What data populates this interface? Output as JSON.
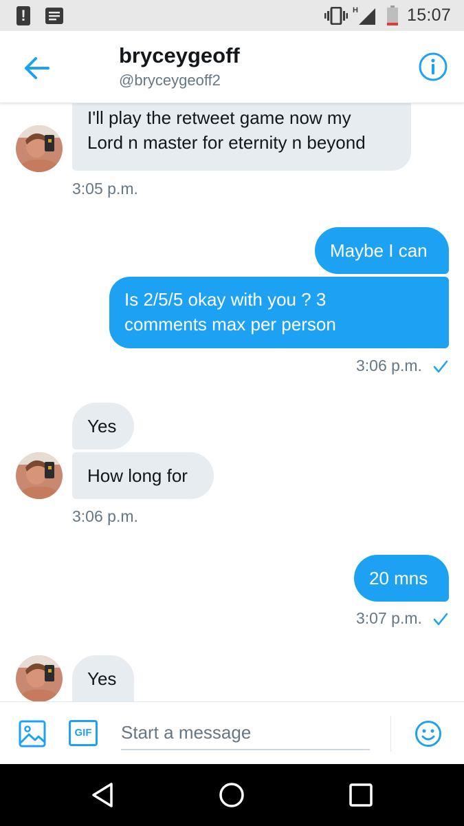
{
  "status_bar": {
    "time": "15:07",
    "network_label": "H",
    "icons": [
      "alert-icon",
      "notes-icon",
      "vibrate-icon",
      "signal-icon",
      "battery-icon"
    ]
  },
  "header": {
    "name": "bryceygeoff",
    "handle": "@bryceygeoff2",
    "icons": [
      "back-arrow-icon",
      "info-icon"
    ]
  },
  "messages": [
    {
      "from": "them",
      "text_lines": [
        "I'll play the retweet game now my",
        "Lord n master for eternity n beyond"
      ]
    },
    {
      "from": "them",
      "timestamp": "3:05 p.m."
    },
    {
      "from": "me",
      "text_lines": [
        "Maybe I can"
      ]
    },
    {
      "from": "me",
      "text_lines": [
        "Is 2/5/5 okay with you ? 3",
        "comments max per person"
      ]
    },
    {
      "from": "me",
      "timestamp": "3:06 p.m.",
      "read": true
    },
    {
      "from": "them",
      "text_lines": [
        "Yes"
      ]
    },
    {
      "from": "them",
      "text_lines": [
        "How long for"
      ]
    },
    {
      "from": "them",
      "timestamp": "3:06 p.m."
    },
    {
      "from": "me",
      "text_lines": [
        "20 mns"
      ]
    },
    {
      "from": "me",
      "timestamp": "3:07 p.m.",
      "read": true
    },
    {
      "from": "them",
      "text_lines": [
        "Yes"
      ]
    }
  ],
  "composer": {
    "placeholder": "Start a message",
    "gif_label": "GIF",
    "icons": [
      "image-icon",
      "gif-icon",
      "emoji-icon"
    ]
  },
  "nav_bar": {
    "icons": [
      "nav-back-icon",
      "nav-home-icon",
      "nav-recents-icon"
    ]
  },
  "colors": {
    "accent": "#1da1f2",
    "incoming_bubble": "#e6ecf0",
    "status_bar": "#e8e8e8",
    "battery_low": "#e53935"
  }
}
